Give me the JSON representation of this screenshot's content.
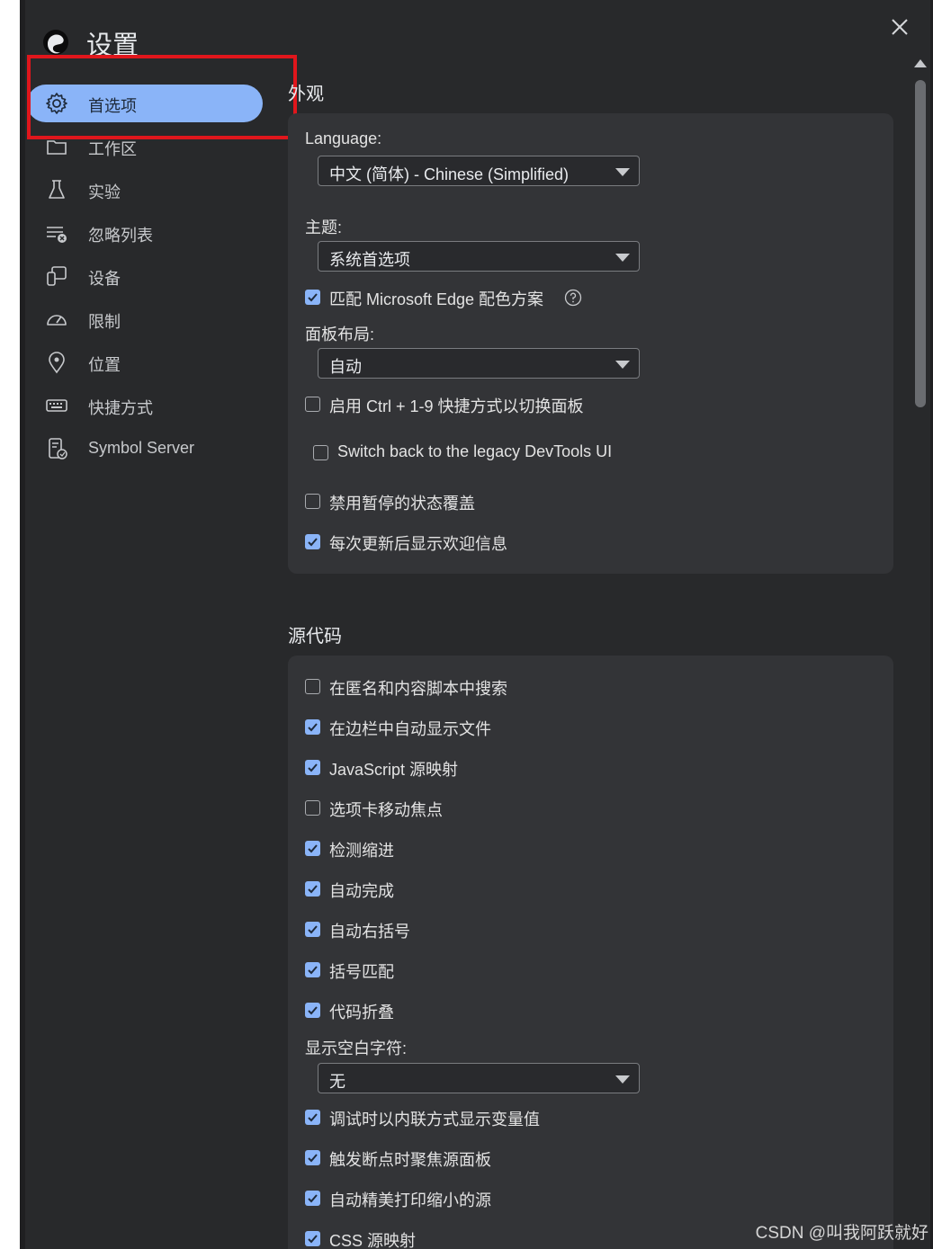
{
  "app": {
    "title": "设置"
  },
  "sidebar": {
    "items": [
      {
        "label": "首选项",
        "icon": "gear-icon",
        "active": true
      },
      {
        "label": "工作区",
        "icon": "folder-icon"
      },
      {
        "label": "实验",
        "icon": "flask-icon"
      },
      {
        "label": "忽略列表",
        "icon": "ignore-list-icon"
      },
      {
        "label": "设备",
        "icon": "devices-icon"
      },
      {
        "label": "限制",
        "icon": "gauge-icon"
      },
      {
        "label": "位置",
        "icon": "location-pin-icon"
      },
      {
        "label": "快捷方式",
        "icon": "keyboard-icon"
      },
      {
        "label": "Symbol Server",
        "icon": "symbol-server-icon"
      }
    ]
  },
  "appearance": {
    "title": "外观",
    "language_label": "Language:",
    "language_value": "中文 (简体) - Chinese (Simplified)",
    "theme_label": "主题:",
    "theme_value": "系统首选项",
    "match_edge": {
      "label": "匹配 Microsoft Edge 配色方案",
      "checked": true
    },
    "panel_layout_label": "面板布局:",
    "panel_layout_value": "自动",
    "ctrl_shortcut": {
      "label": "启用 Ctrl + 1-9 快捷方式以切换面板",
      "checked": false
    },
    "legacy_devtools": {
      "label": "Switch back to the legacy DevTools UI",
      "checked": false
    },
    "disable_paused_overlay": {
      "label": "禁用暂停的状态覆盖",
      "checked": false
    },
    "show_welcome": {
      "label": "每次更新后显示欢迎信息",
      "checked": true
    }
  },
  "sources": {
    "title": "源代码",
    "options": [
      {
        "label": "在匿名和内容脚本中搜索",
        "checked": false
      },
      {
        "label": "在边栏中自动显示文件",
        "checked": true
      },
      {
        "label": "JavaScript 源映射",
        "checked": true
      },
      {
        "label": "选项卡移动焦点",
        "checked": false
      },
      {
        "label": "检测缩进",
        "checked": true
      },
      {
        "label": "自动完成",
        "checked": true
      },
      {
        "label": "自动右括号",
        "checked": true
      },
      {
        "label": "括号匹配",
        "checked": true
      },
      {
        "label": "代码折叠",
        "checked": true
      }
    ],
    "whitespace_label": "显示空白字符:",
    "whitespace_value": "无",
    "options2": [
      {
        "label": "调试时以内联方式显示变量值",
        "checked": true
      },
      {
        "label": "触发断点时聚焦源面板",
        "checked": true
      },
      {
        "label": "自动精美打印缩小的源",
        "checked": true
      },
      {
        "label": "CSS 源映射",
        "checked": true
      }
    ]
  },
  "watermark": "CSDN @叫我阿跃就好",
  "colors": {
    "accent": "#8ab4f8",
    "highlight": "#e0161c",
    "background": "#28292b"
  }
}
